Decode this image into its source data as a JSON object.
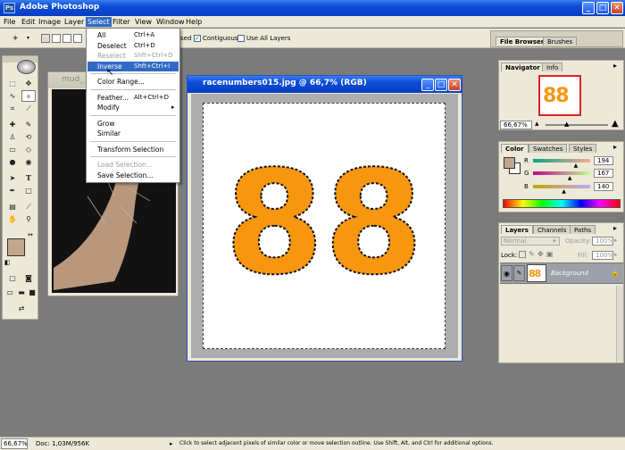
{
  "app": {
    "title": "Adobe Photoshop",
    "logo": "Ps",
    "minimize": "_",
    "maximize": "□",
    "close": "✕"
  },
  "menubar": [
    "File",
    "Edit",
    "Image",
    "Layer",
    "Select",
    "Filter",
    "View",
    "Window",
    "Help"
  ],
  "options_bar": {
    "partial_label": "sed",
    "contiguous_label": "Contiguous",
    "contiguous_checked": true,
    "use_all_layers_label": "Use All Layers",
    "use_all_layers_checked": false
  },
  "select_menu": [
    {
      "label": "All",
      "shortcut": "Ctrl+A",
      "enabled": true
    },
    {
      "label": "Deselect",
      "shortcut": "Ctrl+D",
      "enabled": true
    },
    {
      "label": "Reselect",
      "shortcut": "Shft+Ctrl+D",
      "enabled": false
    },
    {
      "label": "Inverse",
      "shortcut": "Shft+Ctrl+I",
      "enabled": true,
      "highlighted": true
    },
    {
      "separator": true
    },
    {
      "label": "Color Range...",
      "shortcut": "",
      "enabled": true
    },
    {
      "separator": true
    },
    {
      "label": "Feather...",
      "shortcut": "Alt+Ctrl+D",
      "enabled": true
    },
    {
      "label": "Modify",
      "shortcut": "",
      "enabled": true,
      "submenu": true
    },
    {
      "separator": true
    },
    {
      "label": "Grow",
      "shortcut": "",
      "enabled": true
    },
    {
      "label": "Similar",
      "shortcut": "",
      "enabled": true
    },
    {
      "separator": true
    },
    {
      "label": "Transform Selection",
      "shortcut": "",
      "enabled": true
    },
    {
      "separator": true
    },
    {
      "label": "Load Selection...",
      "shortcut": "",
      "enabled": false
    },
    {
      "label": "Save Selection...",
      "shortcut": "",
      "enabled": true
    }
  ],
  "documents": [
    {
      "title": "mud_",
      "active": false
    },
    {
      "title": "racenumbers015.jpg @ 66,7% (RGB)",
      "active": true,
      "content_text": "88",
      "content_color": "#f7960f"
    }
  ],
  "palette_well": {
    "tabs": [
      "File Browser",
      "Brushes"
    ]
  },
  "navigator": {
    "tabs": [
      "Navigator",
      "Info"
    ],
    "zoom": "66,67%",
    "thumbnail_text": "88"
  },
  "color_panel": {
    "tabs": [
      "Color",
      "Swatches",
      "Styles"
    ],
    "channels": [
      {
        "label": "R",
        "value": 194,
        "fraction": 0.76
      },
      {
        "label": "G",
        "value": 167,
        "fraction": 0.655
      },
      {
        "label": "B",
        "value": 140,
        "fraction": 0.55
      }
    ],
    "foreground": "#c2a78c",
    "background": "#ffffff"
  },
  "layers_panel": {
    "tabs": [
      "Layers",
      "Channels",
      "Paths"
    ],
    "blend_mode": "Normal",
    "opacity_label": "Opacity:",
    "opacity": "100%",
    "lock_label": "Lock:",
    "fill_label": "Fill:",
    "fill": "100%",
    "layer_name": "Background",
    "layer_thumb_text": "88"
  },
  "toolbox": {
    "foreground": "#c2a78c",
    "background": "#ffffff"
  },
  "status": {
    "zoom": "66,67%",
    "doc": "Doc: 1,03M/956K",
    "hint": "Click to select adjacent pixels of similar color or move selection outline.  Use Shift, Alt, and Ctrl for additional options."
  }
}
